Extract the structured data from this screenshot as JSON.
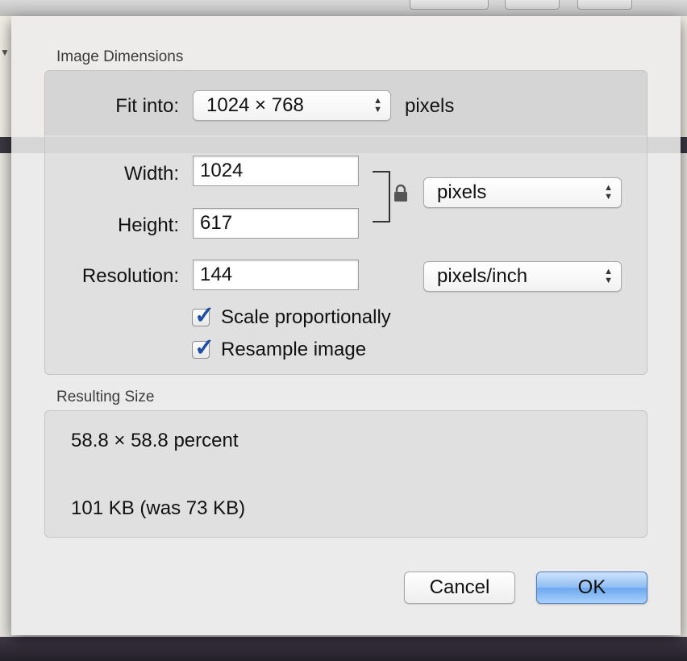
{
  "dialog": {
    "image_dimensions": {
      "title": "Image Dimensions",
      "fit_into_label": "Fit into:",
      "fit_into_value": "1024 × 768",
      "fit_into_unit": "pixels",
      "width_label": "Width:",
      "width_value": "1024",
      "height_label": "Height:",
      "height_value": "617",
      "size_unit": "pixels",
      "resolution_label": "Resolution:",
      "resolution_value": "144",
      "resolution_unit": "pixels/inch",
      "scale_proportionally_label": "Scale proportionally",
      "scale_proportionally_checked": true,
      "resample_label": "Resample image",
      "resample_checked": true
    },
    "resulting_size": {
      "title": "Resulting Size",
      "percent": "58.8 × 58.8 percent",
      "file_size": "101 KB (was 73 KB)"
    },
    "buttons": {
      "cancel": "Cancel",
      "ok": "OK"
    }
  },
  "icons": {
    "lock": "lock-icon",
    "popup_arrows": "up-down-arrows-icon",
    "checkmark": "checkmark-icon"
  },
  "colors": {
    "default_button": "#8ebcf2",
    "checkmark": "#1c4fa6"
  }
}
